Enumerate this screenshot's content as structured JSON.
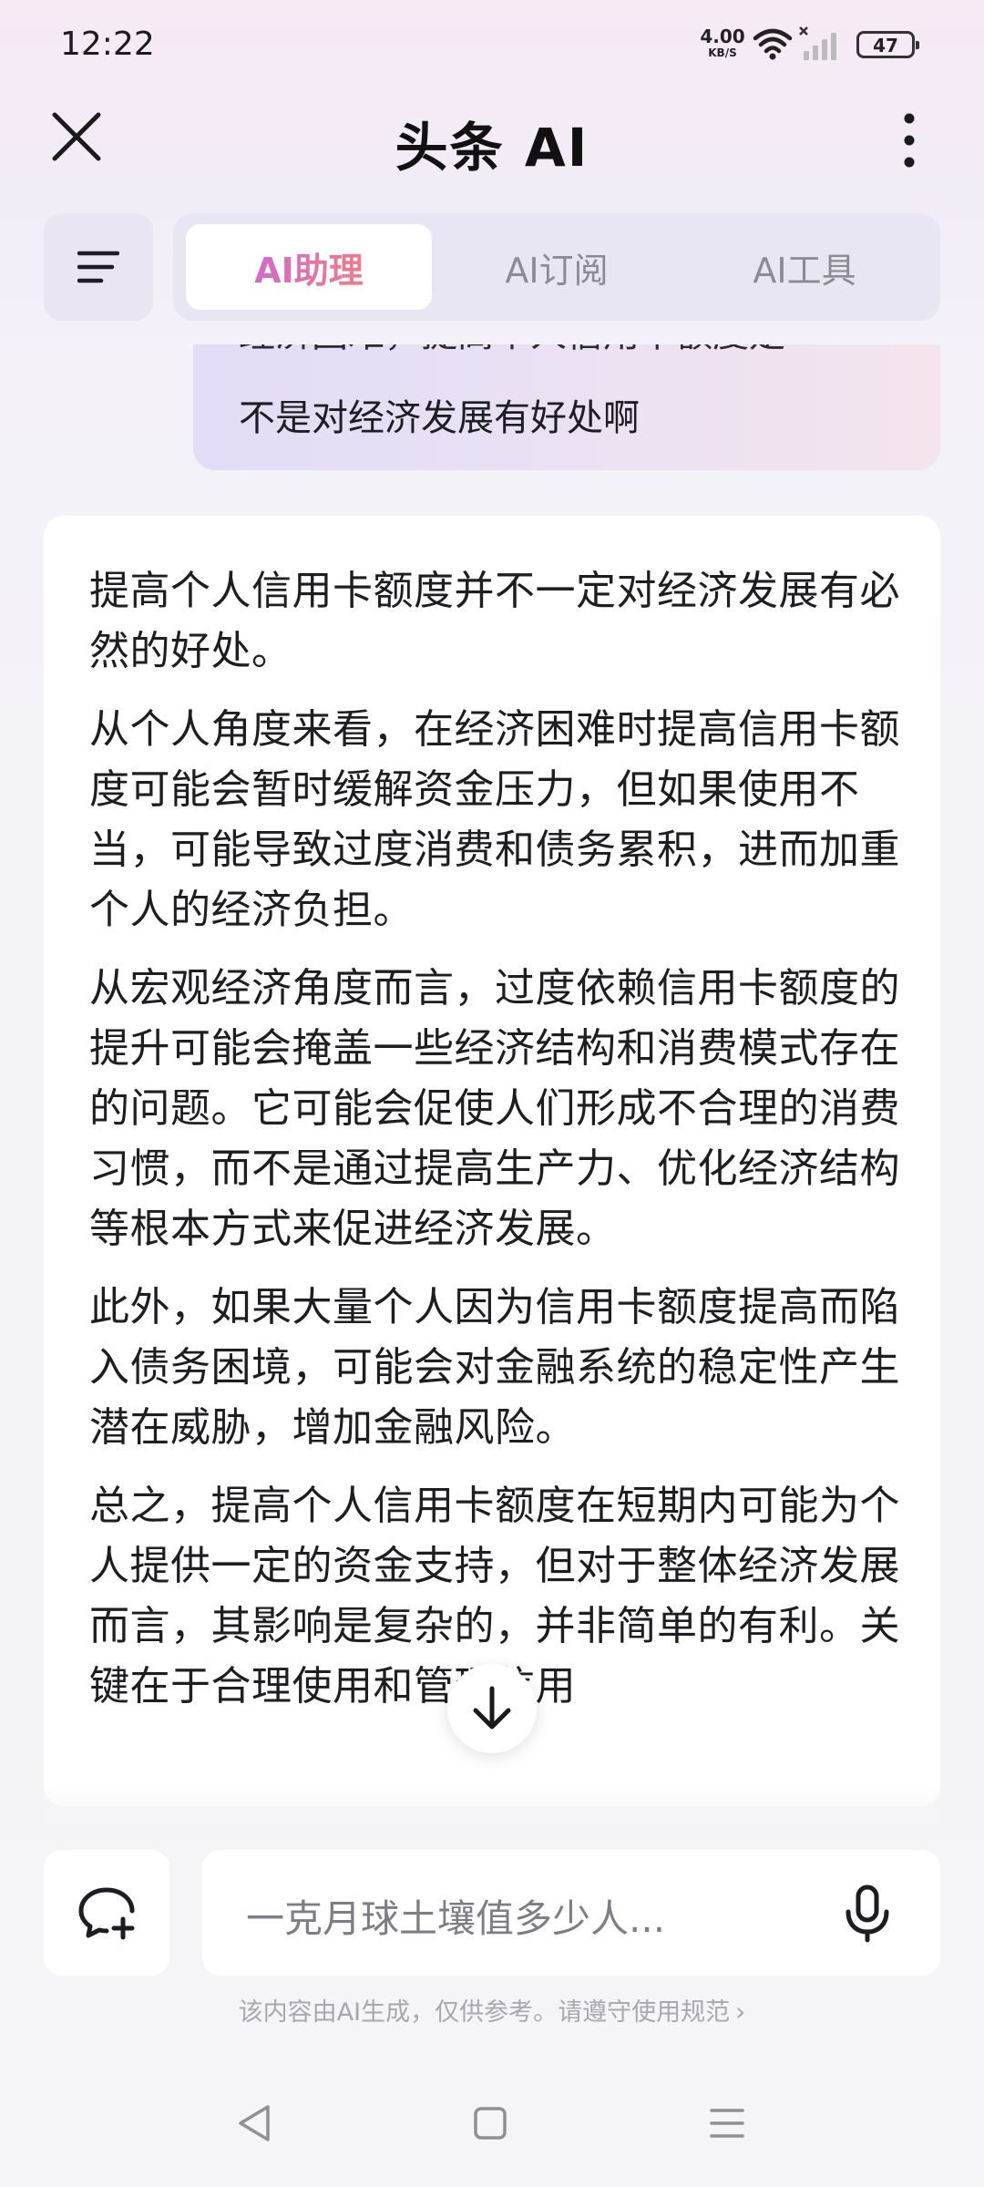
{
  "status_bar": {
    "time": "12:22",
    "net_speed_value": "4.00",
    "net_speed_unit": "KB/S",
    "battery": "47"
  },
  "header": {
    "title": "头条 AI"
  },
  "tabs": [
    {
      "label": "AI助理",
      "active": true
    },
    {
      "label": "AI订阅",
      "active": false
    },
    {
      "label": "AI工具",
      "active": false
    }
  ],
  "user_message": {
    "clipped_line": "经济困难，提高个人信用卡额度是",
    "last_line": "不是对经济发展有好处啊"
  },
  "answer": {
    "paragraphs": [
      "提高个人信用卡额度并不一定对经济发展有必然的好处。",
      "从个人角度来看，在经济困难时提高信用卡额度可能会暂时缓解资金压力，但如果使用不当，可能导致过度消费和债务累积，进而加重个人的经济负担。",
      "从宏观经济角度而言，过度依赖信用卡额度的提升可能会掩盖一些经济结构和消费模式存在的问题。它可能会促使人们形成不合理的消费习惯，而不是通过提高生产力、优化经济结构等根本方式来促进经济发展。",
      "此外，如果大量个人因为信用卡额度提高而陷入债务困境，可能会对金融系统的稳定性产生潜在威胁，增加金融风险。",
      "总之，提高个人信用卡额度在短期内可能为个人提供一定的资金支持，但对于整体经济发展而言，其影响是复杂的，并非简单的有利。关键在于合理使用和管理信用"
    ]
  },
  "input": {
    "placeholder": "一克月球土壤值多少人..."
  },
  "disclaimer": "该内容由AI生成，仅供参考。请遵守使用规范",
  "colors": {
    "accent_gradient_start": "#d46ac8",
    "accent_gradient_end": "#f07a86",
    "tab_inactive": "#8b8b93"
  }
}
